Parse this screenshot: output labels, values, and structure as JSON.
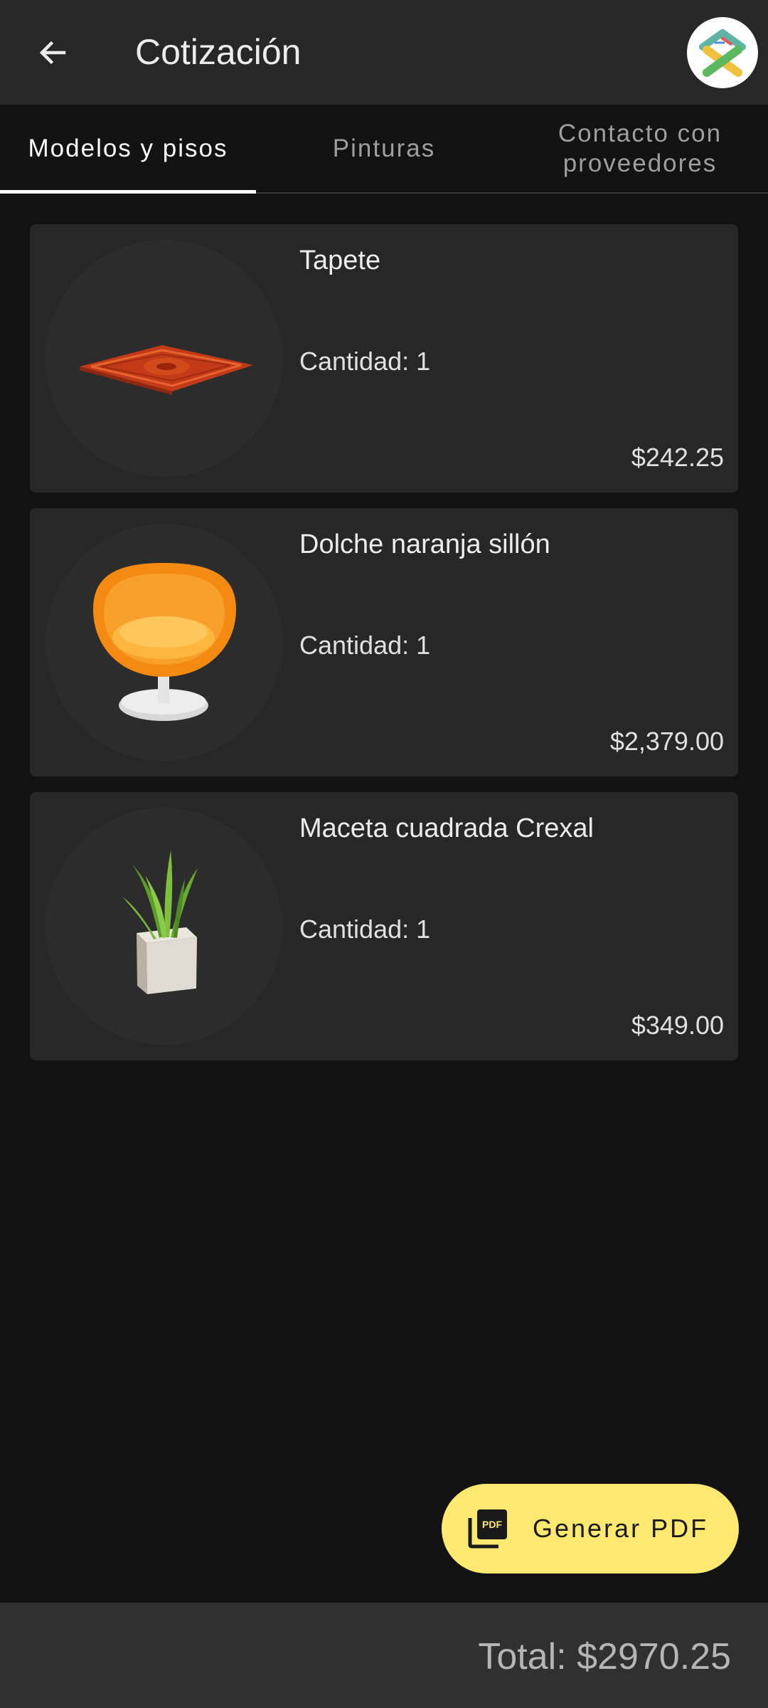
{
  "header": {
    "title": "Cotización",
    "back_icon": "arrow-left-icon",
    "logo_icon": "app-logo"
  },
  "tabs": [
    {
      "label": "Modelos y pisos",
      "active": true
    },
    {
      "label": "Pinturas",
      "active": false
    },
    {
      "label": "Contacto con proveedores",
      "active": false
    }
  ],
  "items": [
    {
      "name": "Tapete",
      "quantity": "Cantidad: 1",
      "price": "$242.25",
      "icon": "rug-image"
    },
    {
      "name": "Dolche naranja sillón",
      "quantity": "Cantidad: 1",
      "price": "$2,379.00",
      "icon": "orange-chair-image"
    },
    {
      "name": "Maceta cuadrada Crexal",
      "quantity": "Cantidad: 1",
      "price": "$349.00",
      "icon": "plant-pot-image"
    }
  ],
  "fab": {
    "label": "Generar PDF",
    "icon": "pdf-icon"
  },
  "footer": {
    "total": "Total: $2970.25"
  },
  "colors": {
    "background": "#121212",
    "appbar": "#272727",
    "card": "#272727",
    "fab": "#fde96f",
    "bottom_bar": "#303030"
  }
}
